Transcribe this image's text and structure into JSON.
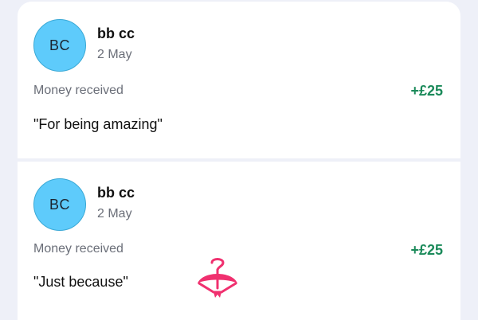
{
  "transactions": [
    {
      "initials": "BC",
      "name": "bb cc",
      "date": "2 May",
      "type": "Money received",
      "amount": "+£25",
      "message": "\"For being amazing\""
    },
    {
      "initials": "BC",
      "name": "bb cc",
      "date": "2 May",
      "type": "Money received",
      "amount": "+£25",
      "message": "\"Just because\""
    }
  ],
  "icons": {
    "overlay": "hanger-icon"
  },
  "colors": {
    "avatar": "#5ecbfb",
    "amount": "#1b8a5a",
    "hanger": "#f0306f",
    "background": "#eef0f8"
  }
}
